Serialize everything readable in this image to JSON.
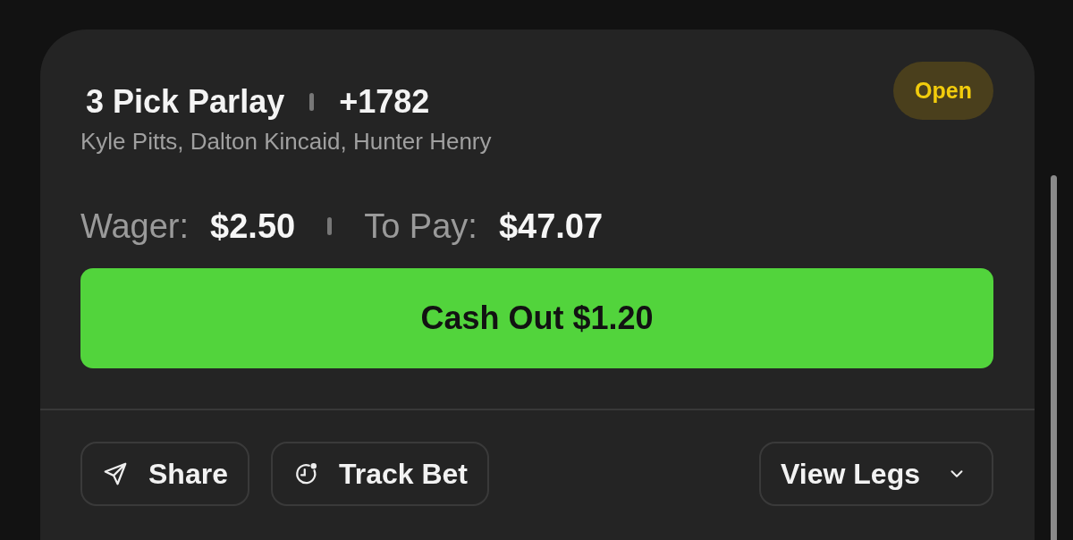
{
  "bet": {
    "title": "3 Pick Parlay",
    "odds": "+1782",
    "players": "Kyle Pitts, Dalton Kincaid, Hunter Henry",
    "status": {
      "label": "Open",
      "kind": "open"
    }
  },
  "amounts": [
    {
      "label": "Wager:",
      "value": "$2.50"
    },
    {
      "label": "To Pay:",
      "value": "$47.07"
    }
  ],
  "cash_out": {
    "label": "Cash Out $1.20"
  },
  "actions": [
    {
      "label": "Share",
      "kind": "share"
    },
    {
      "label": "Track Bet",
      "kind": "track"
    }
  ],
  "legs_toggle": {
    "label": "View Legs",
    "expanded": false
  }
}
